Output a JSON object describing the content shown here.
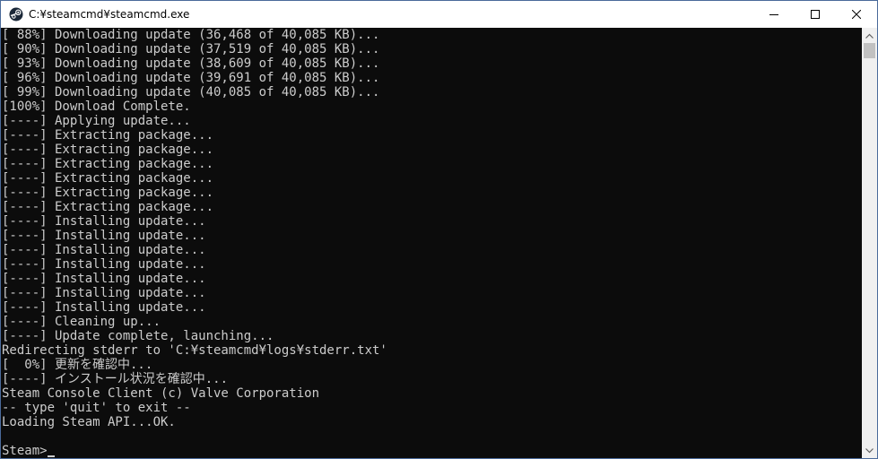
{
  "window": {
    "title": "C:¥steamcmd¥steamcmd.exe",
    "icon": "steam-logo-icon",
    "controls": {
      "minimize": "minimize-icon",
      "maximize": "maximize-icon",
      "close": "close-icon"
    }
  },
  "console": {
    "lines": [
      "[ 88%] Downloading update (36,468 of 40,085 KB)...",
      "[ 90%] Downloading update (37,519 of 40,085 KB)...",
      "[ 93%] Downloading update (38,609 of 40,085 KB)...",
      "[ 96%] Downloading update (39,691 of 40,085 KB)...",
      "[ 99%] Downloading update (40,085 of 40,085 KB)...",
      "[100%] Download Complete.",
      "[----] Applying update...",
      "[----] Extracting package...",
      "[----] Extracting package...",
      "[----] Extracting package...",
      "[----] Extracting package...",
      "[----] Extracting package...",
      "[----] Extracting package...",
      "[----] Installing update...",
      "[----] Installing update...",
      "[----] Installing update...",
      "[----] Installing update...",
      "[----] Installing update...",
      "[----] Installing update...",
      "[----] Installing update...",
      "[----] Cleaning up...",
      "[----] Update complete, launching...",
      "Redirecting stderr to 'C:¥steamcmd¥logs¥stderr.txt'",
      "[  0%] 更新を確認中...",
      "[----] インストール状況を確認中...",
      "Steam Console Client (c) Valve Corporation",
      "-- type 'quit' to exit --",
      "Loading Steam API...OK.",
      ""
    ],
    "prompt": "Steam>",
    "text_color": "#cccccc",
    "background_color": "#0c0c0c"
  }
}
